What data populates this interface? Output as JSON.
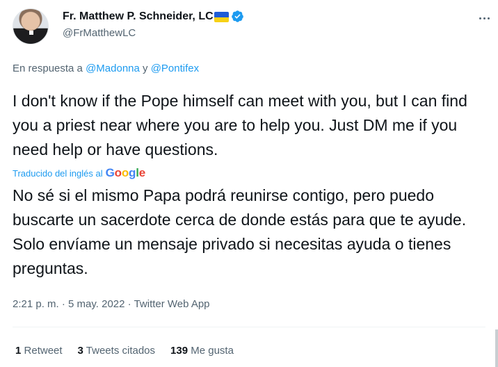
{
  "author": {
    "name": "Fr. Matthew P. Schneider, LC",
    "handle": "@FrMatthewLC",
    "flag_colors": {
      "top": "#1f5cd6",
      "bottom": "#f7d117"
    },
    "verified_icon": "verified-badge-icon"
  },
  "reply_to": {
    "prefix": "En respuesta a",
    "user1": "@Madonna",
    "conjunction": "y",
    "user2": "@Pontifex"
  },
  "tweet": {
    "original_text": "I don't know if the Pope himself can meet with you, but I can find you a priest near where you are to help you. Just DM me if you need help or have questions.",
    "translated_label": "Traducido del inglés al",
    "translator_brand": "Google",
    "translated_text": "No sé si el mismo Papa podrá reunirse contigo, pero puedo buscarte un sacerdote cerca de donde estás para que te ayude. Solo envíame un mensaje privado si necesitas ayuda o tienes preguntas."
  },
  "meta": {
    "time": "2:21 p. m.",
    "separator": "·",
    "date": "5 may. 2022",
    "source": "Twitter Web App"
  },
  "stats": {
    "retweets_count": "1",
    "retweets_label": "Retweet",
    "quotes_count": "3",
    "quotes_label": "Tweets citados",
    "likes_count": "139",
    "likes_label": "Me gusta"
  },
  "colors": {
    "accent": "#1d9bf0",
    "text": "#0f1419",
    "secondary": "#536471",
    "google": [
      "#4285F4",
      "#EA4335",
      "#FBBC05",
      "#4285F4",
      "#34A853",
      "#EA4335"
    ]
  },
  "icons": [
    "more-options-icon",
    "verified-badge-icon",
    "ukraine-flag-icon"
  ]
}
